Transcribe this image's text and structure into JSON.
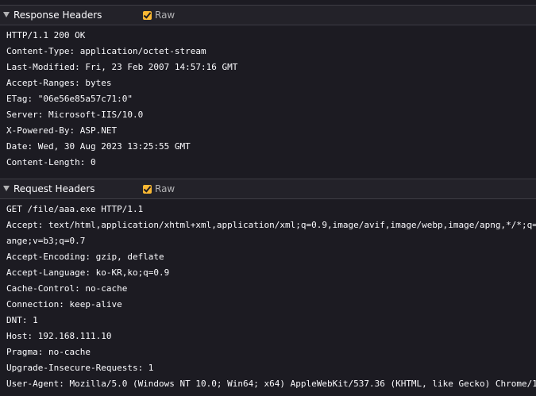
{
  "response_headers": {
    "title": "Response Headers",
    "raw_label": "Raw",
    "raw_checked": true,
    "lines": [
      "HTTP/1.1 200 OK",
      "Content-Type: application/octet-stream",
      "Last-Modified: Fri, 23 Feb 2007 14:57:16 GMT",
      "Accept-Ranges: bytes",
      "ETag: \"06e56e85a57c71:0\"",
      "Server: Microsoft-IIS/10.0",
      "X-Powered-By: ASP.NET",
      "Date: Wed, 30 Aug 2023 13:25:55 GMT",
      "Content-Length: 0"
    ]
  },
  "request_headers": {
    "title": "Request Headers",
    "raw_label": "Raw",
    "raw_checked": true,
    "lines": [
      "GET /file/aaa.exe HTTP/1.1",
      "Accept: text/html,application/xhtml+xml,application/xml;q=0.9,image/avif,image/webp,image/apng,*/*;q=",
      "ange;v=b3;q=0.7",
      "Accept-Encoding: gzip, deflate",
      "Accept-Language: ko-KR,ko;q=0.9",
      "Cache-Control: no-cache",
      "Connection: keep-alive",
      "DNT: 1",
      "Host: 192.168.111.10",
      "Pragma: no-cache",
      "Upgrade-Insecure-Requests: 1",
      "User-Agent: Mozilla/5.0 (Windows NT 10.0; Win64; x64) AppleWebKit/537.36 (KHTML, like Gecko) Chrome/1"
    ]
  },
  "colors": {
    "background": "#1c1b22",
    "header_background": "#232229",
    "text": "#fbfbfe",
    "checkbox_accent": "#f9b833",
    "muted_text": "#b1b1b3"
  },
  "icons": {
    "collapse_toggle": "caret-down-icon",
    "checkbox": "checkmark-icon"
  }
}
